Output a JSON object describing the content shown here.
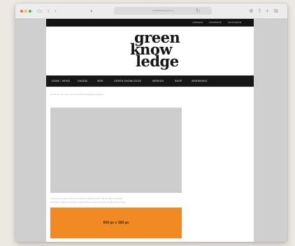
{
  "browser": {
    "address": "a.nederlandsegreen.nl",
    "lights": [
      "#ff5f57",
      "#febc2e",
      "#28c840"
    ]
  },
  "site": {
    "top_links": [
      "LINKEDIN",
      "FACEBOOK",
      "INSTAGRAM"
    ],
    "logo_lines": [
      "green",
      "know",
      "ledge"
    ],
    "nav": [
      "HOME / NEWS",
      "HANDEL",
      "WEB",
      "GREEN KNOWLEDGE",
      "MERKEN",
      "SHOP",
      "WEBWINKEL"
    ],
    "intro": "Op de site van vorm een moment knowledge/dit dingetjes",
    "caption": [
      "Lorem ipsum dolor sit amet consectetur adipiscing elit sed do eiusmod tempor",
      "incididunt ut labore et dolore magna aliqua ut enim ad minim veniam quis nostrud"
    ],
    "banner_label": "600 px x 160 px",
    "accent": "#f28a24"
  }
}
